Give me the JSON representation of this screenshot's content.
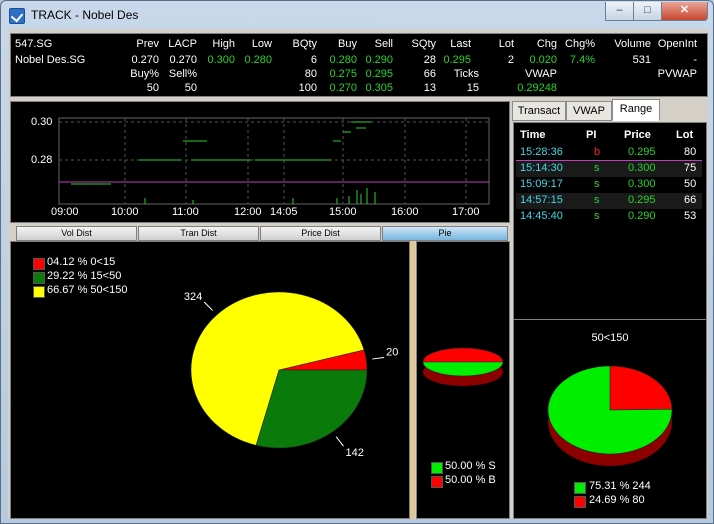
{
  "window": {
    "title": "TRACK - Nobel Des",
    "minimize": "–",
    "maximize": "□",
    "close": "✕"
  },
  "quote": {
    "code": "547.SG",
    "name": "Nobel Des.SG",
    "headers": [
      "Prev",
      "LACP",
      "High",
      "Low",
      "BQty",
      "Buy",
      "Sell",
      "SQty",
      "Last",
      "Lot",
      "Chg",
      "Chg%",
      "Volume",
      "OpenInt"
    ],
    "row1": {
      "prev": "0.270",
      "lacp": "0.270",
      "high": "0.300",
      "low": "0.280",
      "bqty": "6",
      "buy": "0.280",
      "sell": "0.290",
      "sqty": "28",
      "last": "0.295",
      "lot": "2",
      "chg": "0.020",
      "chgpct": "7.4%",
      "volume": "531",
      "openint": "-"
    },
    "row2": {
      "buypct_label": "Buy%",
      "sellpct_label": "Sell%",
      "bqty": "80",
      "buy": "0.275",
      "sell": "0.295",
      "sqty": "66",
      "ticks_label": "Ticks",
      "vwap_label": "VWAP",
      "pvwap_label": "PVWAP"
    },
    "row3": {
      "buypct": "50",
      "sellpct": "50",
      "bqty": "100",
      "buy": "0.270",
      "sell": "0.305",
      "sqty": "13",
      "ticks": "15",
      "vwap": "0.29248"
    }
  },
  "intraday": {
    "y_ticks": [
      "0.30",
      "0.28"
    ],
    "x_ticks": [
      "09:00",
      "10:00",
      "11:00",
      "12:00",
      "14:05",
      "15:00",
      "16:00",
      "17:00"
    ]
  },
  "side_tabs": [
    "Transact",
    "VWAP",
    "Range"
  ],
  "active_tab": "Range",
  "range_table": {
    "headers": [
      "Time",
      "PI",
      "Price",
      "Lot"
    ],
    "rows": [
      {
        "time": "15:28:36",
        "pi": "b",
        "price": "0.295",
        "lot": "80"
      },
      {
        "time": "15:14:30",
        "pi": "s",
        "price": "0.300",
        "lot": "75"
      },
      {
        "time": "15:09:17",
        "pi": "s",
        "price": "0.300",
        "lot": "50"
      },
      {
        "time": "14:57:15",
        "pi": "s",
        "price": "0.295",
        "lot": "66"
      },
      {
        "time": "14:45:40",
        "pi": "s",
        "price": "0.290",
        "lot": "53"
      }
    ]
  },
  "dist_buttons": [
    "Vol Dist",
    "Tran Dist",
    "Price Dist",
    "Pie"
  ],
  "active_dist": "Pie",
  "colors": {
    "red": "#ff0000",
    "green": "#0a7a0a",
    "yellow": "#ffff00",
    "bright_green": "#00ee00"
  },
  "chart_data": [
    {
      "type": "pie",
      "legend": [
        "04.12 %  0<15",
        "29.22 %  15<50",
        "66.67 %  50<150"
      ],
      "slices": [
        {
          "label": "20",
          "value": 20,
          "percent": 4.12,
          "color": "#ff0000"
        },
        {
          "label": "142",
          "value": 142,
          "percent": 29.22,
          "color": "#0a7a0a"
        },
        {
          "label": "324",
          "value": 324,
          "percent": 66.67,
          "color": "#ffff00"
        }
      ]
    },
    {
      "type": "pie",
      "legend": [
        "50.00 % S",
        "50.00 % B"
      ],
      "slices": [
        {
          "label": "S",
          "percent": 50.0,
          "color": "#00ee00"
        },
        {
          "label": "B",
          "percent": 50.0,
          "color": "#ff0000"
        }
      ]
    },
    {
      "type": "pie",
      "title": "50<150",
      "legend": [
        "75.31 % 244",
        "24.69 % 80"
      ],
      "slices": [
        {
          "label": "244",
          "value": 244,
          "percent": 75.31,
          "color": "#00ee00"
        },
        {
          "label": "80",
          "value": 80,
          "percent": 24.69,
          "color": "#ff0000"
        }
      ]
    }
  ]
}
